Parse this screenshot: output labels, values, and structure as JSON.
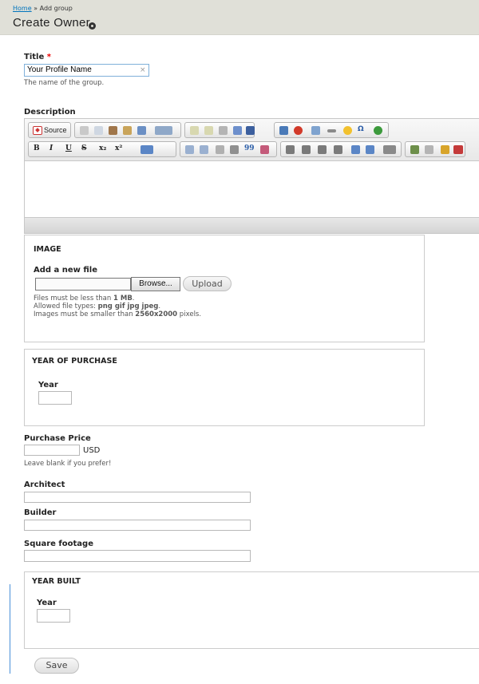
{
  "header": {
    "breadcrumb_home": "Home",
    "breadcrumb_sep": " » ",
    "breadcrumb_current": "Add group",
    "page_title": "Create Owner"
  },
  "title_field": {
    "label": "Title",
    "required_mark": "*",
    "value": "Your Profile Name",
    "clear": "×",
    "description": "The name of the group."
  },
  "description_field": {
    "label": "Description",
    "source_label": "Source"
  },
  "image_fieldset": {
    "legend": "IMAGE",
    "add_label": "Add a new file",
    "browse_label": "Browse...",
    "upload_label": "Upload",
    "help_size_prefix": "Files must be less than ",
    "help_size_value": "1 MB",
    "help_size_suffix": ".",
    "help_types_prefix": "Allowed file types: ",
    "help_types_value": "png gif jpg jpeg",
    "help_types_suffix": ".",
    "help_dims_prefix": "Images must be smaller than ",
    "help_dims_value": "2560x2000",
    "help_dims_suffix": " pixels."
  },
  "year_of_purchase": {
    "legend": "YEAR OF PURCHASE",
    "year_label": "Year"
  },
  "purchase_price": {
    "label": "Purchase Price",
    "currency": "USD",
    "description": "Leave blank if you prefer!"
  },
  "architect": {
    "label": "Architect"
  },
  "builder": {
    "label": "Builder"
  },
  "square_footage": {
    "label": "Square footage"
  },
  "year_built": {
    "legend": "YEAR BUILT",
    "year_label": "Year"
  },
  "actions": {
    "save_label": "Save"
  },
  "colors": {
    "header_bg": "#e0e0d8",
    "link": "#0074bd",
    "required": "#ee0000",
    "focus_border": "#7fb0da"
  },
  "toolbar_icons": {
    "row1": [
      "source-icon",
      "cut-icon",
      "copy-icon",
      "paste-icon",
      "paste-text-icon",
      "paste-word-icon",
      "spellcheck-icon",
      "undo-icon",
      "redo-icon",
      "find-icon",
      "replace-icon",
      "select-all-icon",
      "image-icon",
      "flash-icon",
      "table-icon",
      "horizontal-rule-icon",
      "smiley-icon",
      "special-char-icon",
      "iframe-icon"
    ],
    "row2": [
      "bold-icon",
      "italic-icon",
      "underline-icon",
      "strike-icon",
      "subscript-icon",
      "superscript-icon",
      "remove-format-icon",
      "numbered-list-icon",
      "bulleted-list-icon",
      "outdent-icon",
      "indent-icon",
      "blockquote-icon",
      "div-icon",
      "align-left-icon",
      "align-center-icon",
      "align-right-icon",
      "justify-icon",
      "ltr-icon",
      "rtl-icon",
      "language-icon",
      "link-icon",
      "unlink-icon",
      "anchor-icon",
      "media-icon"
    ]
  }
}
